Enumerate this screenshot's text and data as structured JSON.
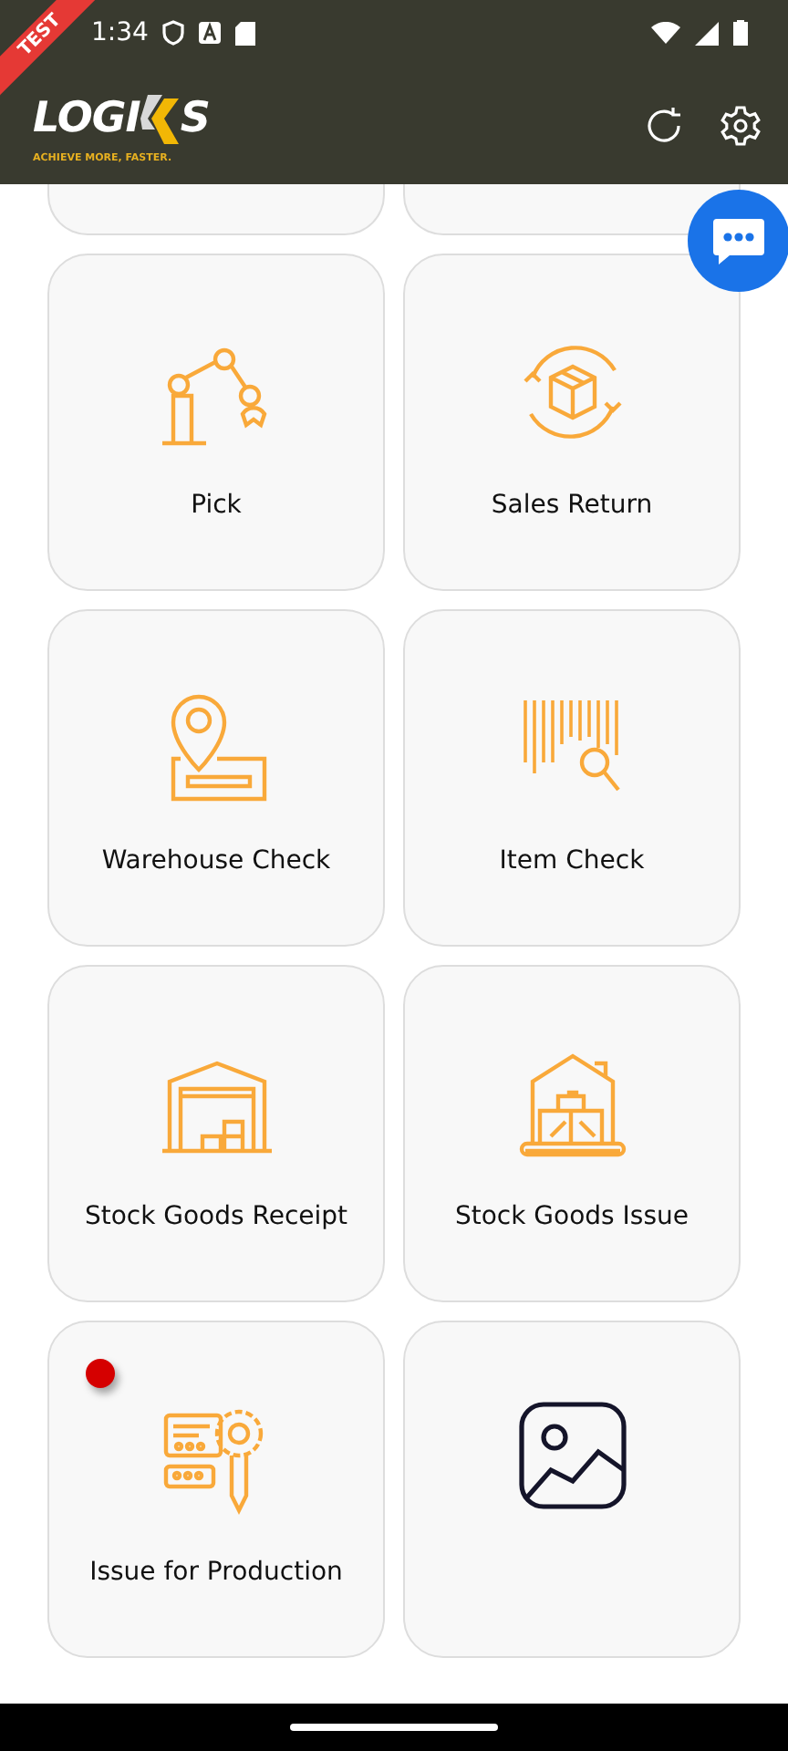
{
  "status_bar": {
    "time": "1:34"
  },
  "ribbon": "TEST",
  "logo": {
    "left": "LOGI",
    "right": "S",
    "tagline": "ACHIEVE MORE, FASTER."
  },
  "tiles": [
    {
      "kind": "robot-arm",
      "label": "Pick",
      "badge": false
    },
    {
      "kind": "box-cycle",
      "label": "Sales Return",
      "badge": false
    },
    {
      "kind": "location",
      "label": "Warehouse Check",
      "badge": false
    },
    {
      "kind": "barcode",
      "label": "Item Check",
      "badge": false
    },
    {
      "kind": "warehouse",
      "label": "Stock Goods Receipt",
      "badge": false
    },
    {
      "kind": "house-goods",
      "label": "Stock Goods Issue",
      "badge": false
    },
    {
      "kind": "production",
      "label": "Issue for Production",
      "badge": true
    },
    {
      "kind": "image",
      "badge": false
    }
  ]
}
